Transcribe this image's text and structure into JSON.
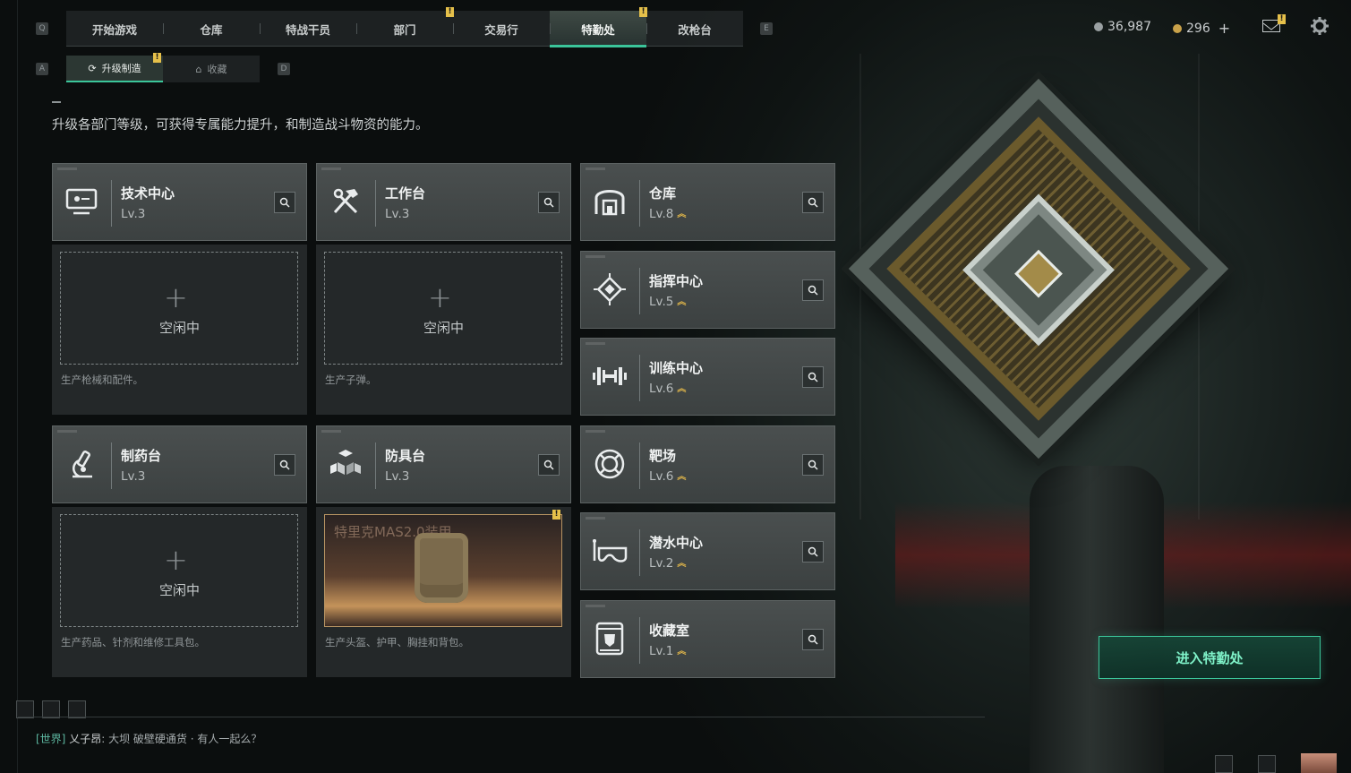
{
  "top_nav": {
    "key_left": "Q",
    "key_right": "E",
    "tabs": [
      {
        "label": "开始游戏",
        "badge": ""
      },
      {
        "label": "仓库",
        "badge": ""
      },
      {
        "label": "特战干员",
        "badge": ""
      },
      {
        "label": "部门",
        "badge": "!"
      },
      {
        "label": "交易行",
        "badge": ""
      },
      {
        "label": "特勤处",
        "badge": "!",
        "active": true
      },
      {
        "label": "改枪台",
        "badge": ""
      }
    ]
  },
  "currency": {
    "coins": "36,987",
    "premium": "296",
    "add": "+"
  },
  "sub_nav": {
    "key_left": "A",
    "key_right": "D",
    "tabs": [
      {
        "label": "升级制造",
        "badge": "!",
        "active": true
      },
      {
        "label": "收藏",
        "badge": ""
      }
    ]
  },
  "description": "升级各部门等级，可获得专属能力提升，和制造战斗物资的能力。",
  "production": [
    {
      "name": "技术中心",
      "level": "Lv.3",
      "status": "空闲中",
      "note": "生产枪械和配件。",
      "icon": "computer-icon"
    },
    {
      "name": "工作台",
      "level": "Lv.3",
      "status": "空闲中",
      "note": "生产子弹。",
      "icon": "tools-icon"
    },
    {
      "name": "制药台",
      "level": "Lv.3",
      "status": "空闲中",
      "note": "生产药品、针剂和维修工具包。",
      "icon": "microscope-icon"
    },
    {
      "name": "防具台",
      "level": "Lv.3",
      "status": "特里克MAS2.0装甲",
      "note": "生产头盔、护甲、胸挂和背包。",
      "icon": "cubes-icon",
      "producing": true,
      "badge": "!"
    }
  ],
  "departments": [
    {
      "name": "仓库",
      "level": "Lv.8",
      "icon": "warehouse-icon"
    },
    {
      "name": "指挥中心",
      "level": "Lv.5",
      "icon": "chip-icon"
    },
    {
      "name": "训练中心",
      "level": "Lv.6",
      "icon": "dumbbell-icon"
    },
    {
      "name": "靶场",
      "level": "Lv.6",
      "icon": "target-icon"
    },
    {
      "name": "潜水中心",
      "level": "Lv.2",
      "icon": "goggles-icon"
    },
    {
      "name": "收藏室",
      "level": "Lv.1",
      "icon": "trophy-case-icon"
    }
  ],
  "enter_button": "进入特勤处",
  "chat": {
    "channel": "[世界]",
    "user": "乂子昂",
    "message": ": 大坝  破壁硬通货 · 有人一起么？"
  },
  "colors": {
    "accent": "#3bc59a",
    "badge": "#e5c04a",
    "upgrade": "#e3b84a"
  }
}
